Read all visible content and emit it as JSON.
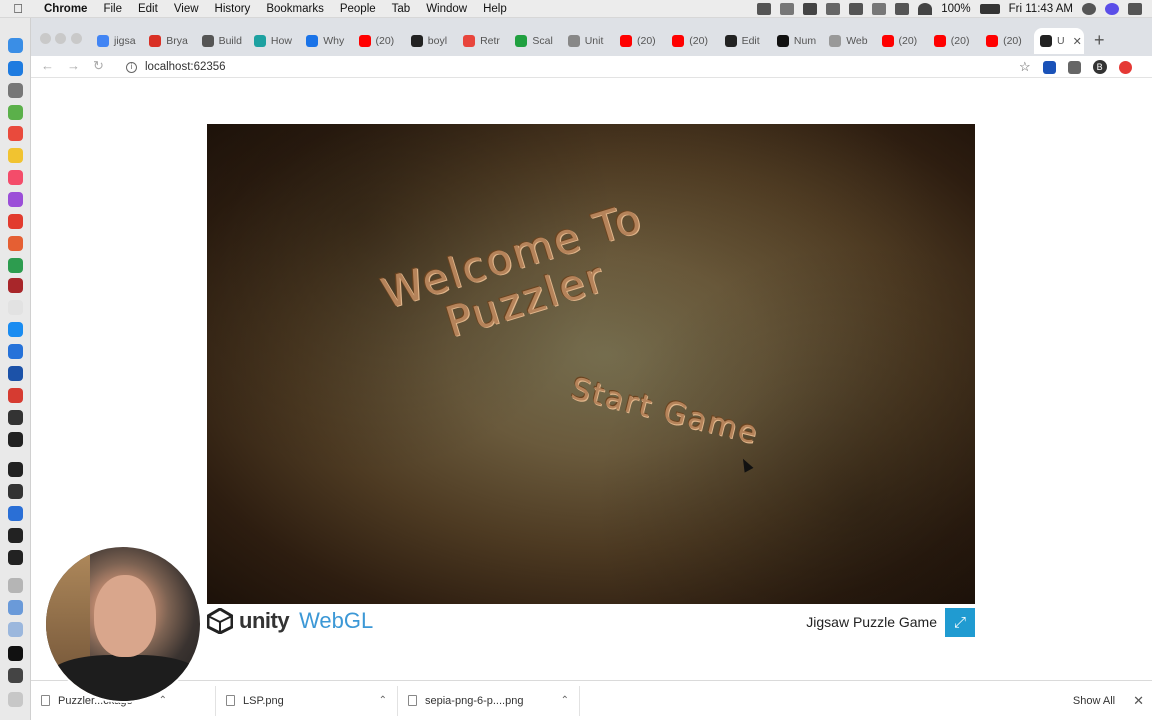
{
  "menubar": {
    "app": "Chrome",
    "items": [
      "File",
      "Edit",
      "View",
      "History",
      "Bookmarks",
      "People",
      "Tab",
      "Window",
      "Help"
    ],
    "battery": "100%",
    "clock": "Fri 11:43 AM"
  },
  "tabs": [
    {
      "label": "jigsa",
      "color": "#4285f4"
    },
    {
      "label": "Brya",
      "color": "#d93025"
    },
    {
      "label": "Build",
      "color": "#555555"
    },
    {
      "label": "How",
      "color": "#1da1a1"
    },
    {
      "label": "Why",
      "color": "#1a73e8"
    },
    {
      "label": "(20)",
      "color": "#ff0000"
    },
    {
      "label": "boyl",
      "color": "#222222"
    },
    {
      "label": "Retr",
      "color": "#e8453c"
    },
    {
      "label": "Scal",
      "color": "#20a040"
    },
    {
      "label": "Unit",
      "color": "#888888"
    },
    {
      "label": "(20)",
      "color": "#ff0000"
    },
    {
      "label": "(20)",
      "color": "#ff0000"
    },
    {
      "label": "Edit",
      "color": "#222222"
    },
    {
      "label": "Num",
      "color": "#111111"
    },
    {
      "label": "Web",
      "color": "#999999"
    },
    {
      "label": "(20)",
      "color": "#ff0000"
    },
    {
      "label": "(20)",
      "color": "#ff0000"
    },
    {
      "label": "(20)",
      "color": "#ff0000"
    }
  ],
  "active_tab": {
    "label": "U"
  },
  "toolbar": {
    "url": "localhost:62356",
    "profile_initial": "B"
  },
  "game": {
    "welcome_line1": "Welcome To",
    "welcome_line2": "Puzzler",
    "start_label": "Start Game"
  },
  "unity_footer": {
    "logo_word": "unity",
    "logo_suffix": "WebGL",
    "title": "Jigsaw Puzzle Game"
  },
  "downloads": [
    {
      "name": "Puzzler...ckage"
    },
    {
      "name": "LSP.png"
    },
    {
      "name": "sepia-png-6-p....png"
    }
  ],
  "shelf": {
    "show_all": "Show All"
  }
}
